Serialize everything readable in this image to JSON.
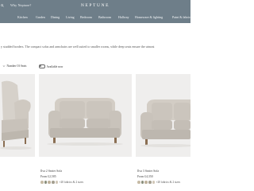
{
  "header": {
    "search_text": "Why Neptune?",
    "brand": "NEPTUNE",
    "categories": [
      "Kitchen",
      "Garden",
      "Dining",
      "Living",
      "Bedroom",
      "Bathroom",
      "Hallway",
      "Homeware & lighting",
      "Paint & fabrics"
    ]
  },
  "intro": {
    "text": "y studded borders. The compact sofas and armchairs are well suited to smaller rooms, while deep seats ensure the utmost"
  },
  "filters": {
    "number_of_seats": "Number Of Seats",
    "available_now": "Available now"
  },
  "products": [
    {
      "name": "",
      "price": "",
      "swatches_text": ""
    },
    {
      "name": "Ilva 2 Seater Sofa",
      "price": "From £2,585",
      "swatches_text": "+20 fabrics & 2 sizes",
      "swatch_colors": [
        "#c7bba6",
        "#8b8f7c",
        "#bfb29c",
        "#a49f90",
        "#d1c7b8"
      ]
    },
    {
      "name": "Ilva 3 Seater Sofa",
      "price": "From £4,350",
      "swatches_text": "+20 fabrics & 2 sizes",
      "swatch_colors": [
        "#c7bba6",
        "#8b8f7c",
        "#bfb29c",
        "#a49f90",
        "#d1c7b8"
      ]
    }
  ],
  "colors": {
    "header_bg": "#6e7e89",
    "image_bg": "#efeeed",
    "sofa_fabric": "#c9c3bb"
  }
}
